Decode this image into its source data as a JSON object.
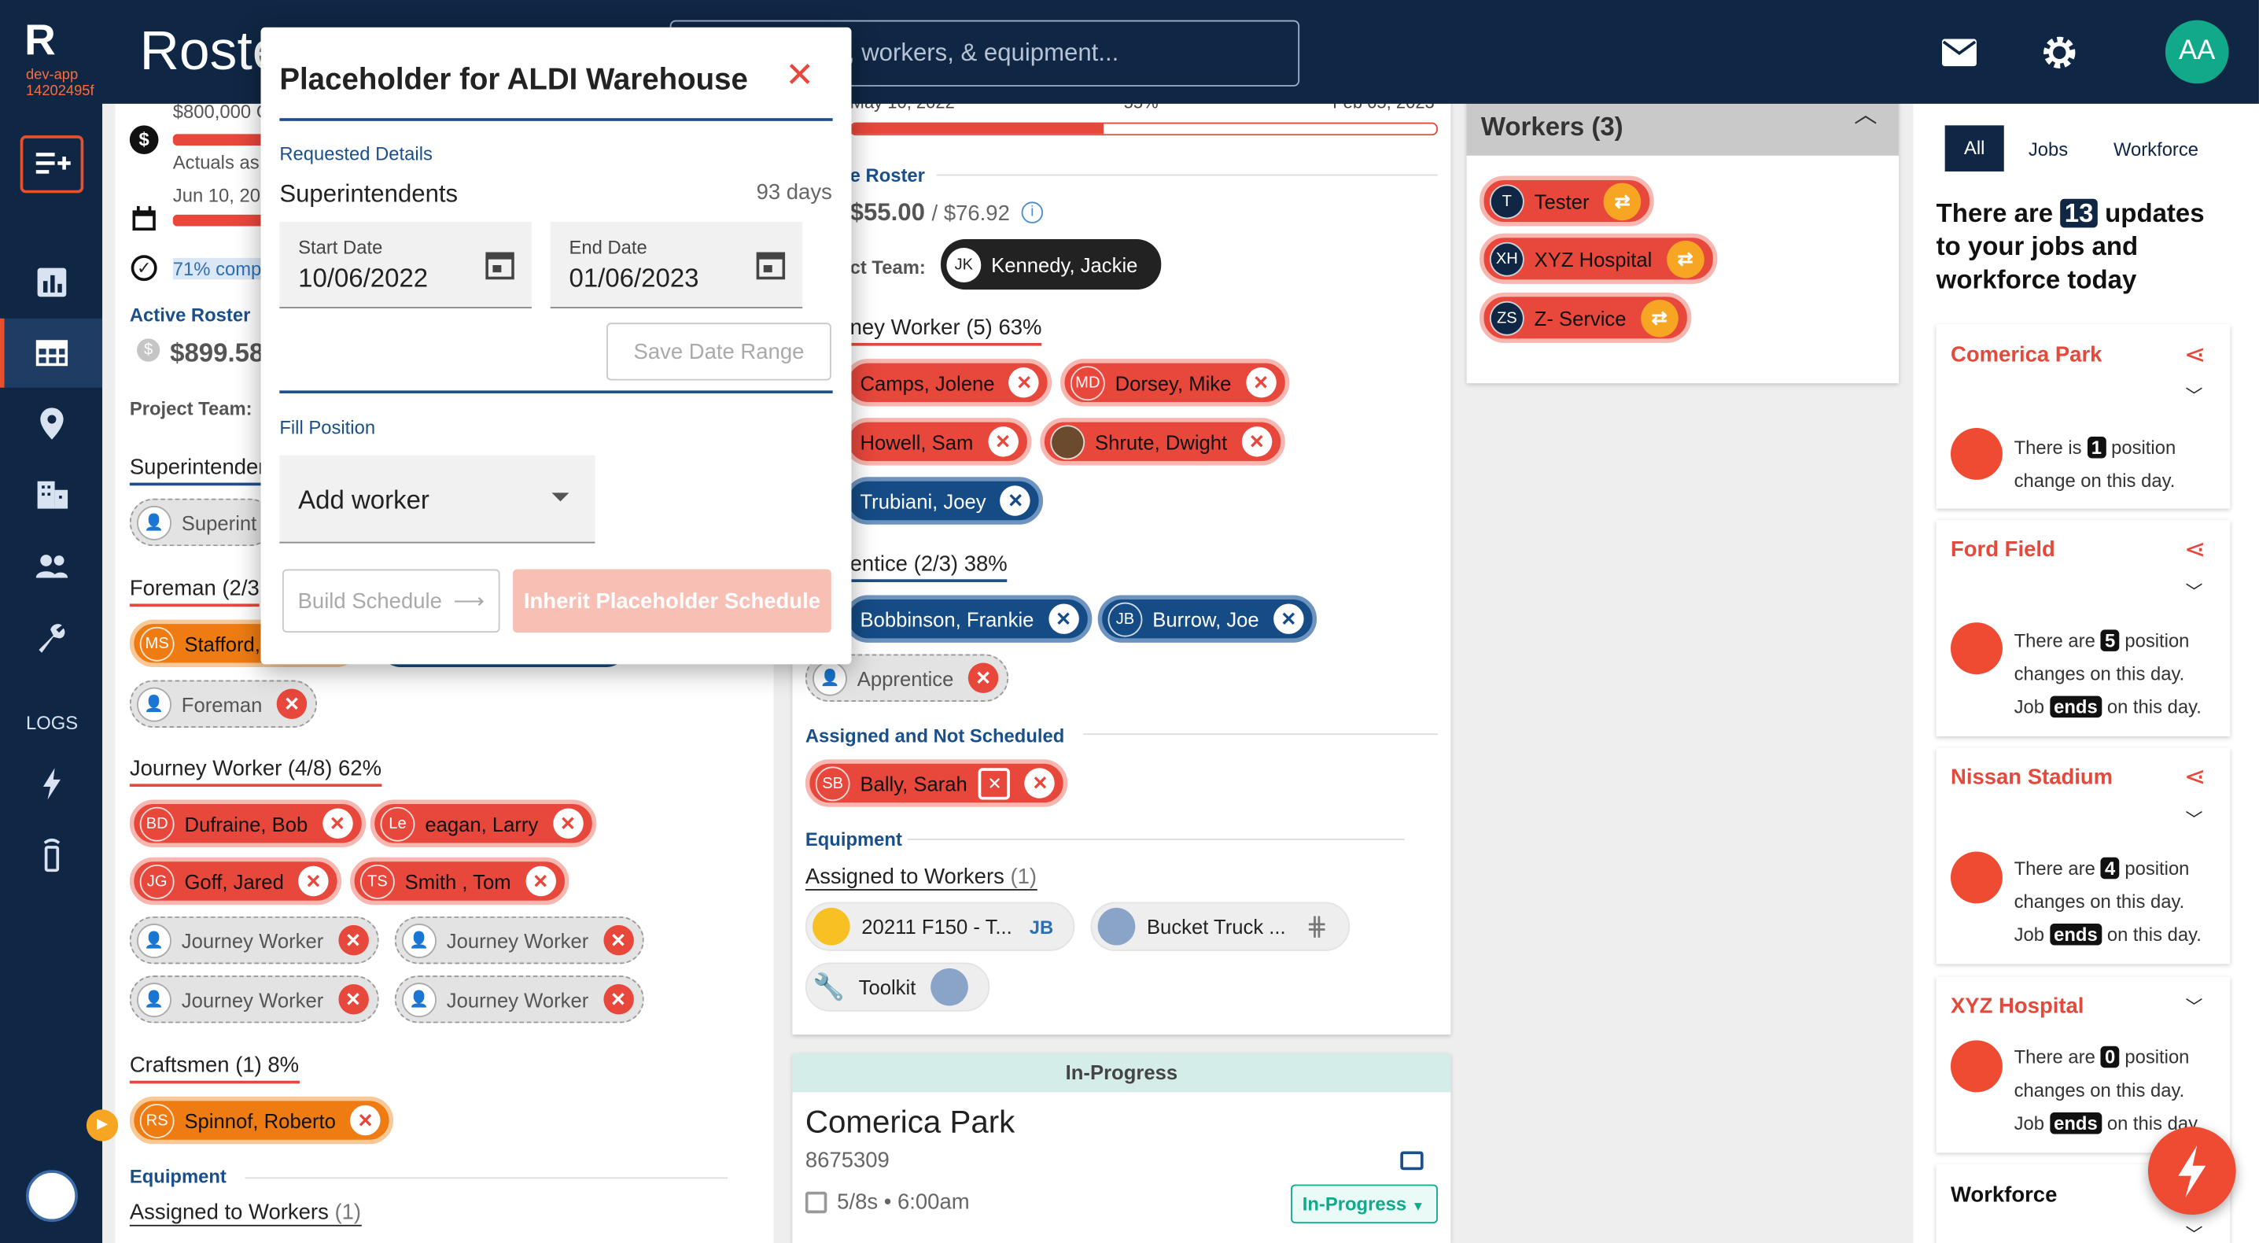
{
  "app": {
    "title": "Roste",
    "logo": "R",
    "env": "dev-app",
    "build": "14202495f",
    "user_initials": "AA",
    "logs_label": "LOGS"
  },
  "search": {
    "placeholder": "s, workers, & equipment..."
  },
  "modal": {
    "title": "Placeholder for ALDI Warehouse",
    "requested_label": "Requested Details",
    "role": "Superintendents",
    "duration": "93 days",
    "start_label": "Start Date",
    "start_value": "10/06/2022",
    "end_label": "End Date",
    "end_value": "01/06/2023",
    "save_range": "Save Date Range",
    "fill_label": "Fill Position",
    "add_worker": "Add worker",
    "build_schedule": "Build Schedule",
    "inherit_schedule": "Inherit Placeholder Schedule"
  },
  "left_panel": {
    "budget": "$800,000 C",
    "actuals": "Actuals as",
    "date": "Jun 10, 20",
    "completion": "71% comp",
    "active_roster_label": "Active Roster",
    "active_roster_value": "$899.58",
    "project_team_label": "Project Team:",
    "superintendent_section": "Superintenden",
    "superintendent_placeholder": "Superint",
    "foreman_section": "Foreman (2/3",
    "foreman_workers": [
      {
        "initials": "MS",
        "name": "Stafford,"
      }
    ],
    "foreman_placeholder": "Foreman",
    "journey_section": "Journey Worker (4/8) 62%",
    "journey_workers": [
      {
        "initials": "BD",
        "name": "Dufraine, Bob"
      },
      {
        "initials": "Le",
        "name": "eagan, Larry"
      },
      {
        "initials": "JG",
        "name": "Goff, Jared"
      },
      {
        "initials": "TS",
        "name": "Smith , Tom"
      }
    ],
    "journey_placeholders": [
      "Journey Worker",
      "Journey Worker",
      "Journey Worker",
      "Journey Worker"
    ],
    "craftsmen_section": "Craftsmen (1) 8%",
    "craftsmen_workers": [
      {
        "initials": "RS",
        "name": "Spinnof, Roberto"
      }
    ],
    "equipment_label": "Equipment",
    "assigned_label": "Assigned to Workers",
    "assigned_count": "(1)"
  },
  "middle_panel": {
    "date_start": "May 10, 2022",
    "progress_pct": "55%",
    "date_end": "Feb 05, 2023",
    "progress_fraction": 0.43,
    "roster_label": "e Roster",
    "roster_value": "$55.00",
    "roster_total": "/ $76.92",
    "team_label": "ct Team:",
    "team_lead": {
      "initials": "JK",
      "name": "Kennedy, Jackie"
    },
    "journey_section": "ney Worker (5) 63%",
    "journey_workers": [
      {
        "initials": "",
        "name": "Camps, Jolene",
        "style": "red"
      },
      {
        "initials": "MD",
        "name": "Dorsey, Mike",
        "style": "red"
      },
      {
        "initials": "",
        "name": "Howell, Sam",
        "style": "red"
      },
      {
        "initials": "",
        "name": "Shrute, Dwight",
        "style": "red"
      },
      {
        "initials": "",
        "name": "Trubiani, Joey",
        "style": "blue"
      }
    ],
    "apprentice_section": "entice (2/3) 38%",
    "apprentice_workers": [
      {
        "initials": "",
        "name": "Bobbinson, Frankie"
      },
      {
        "initials": "JB",
        "name": "Burrow, Joe"
      }
    ],
    "apprentice_placeholder": "Apprentice",
    "not_scheduled_label": "Assigned and Not Scheduled",
    "not_scheduled_workers": [
      {
        "initials": "SB",
        "name": "Bally, Sarah"
      }
    ],
    "equipment_label": "Equipment",
    "assigned_label": "Assigned to Workers",
    "assigned_count": "(1)",
    "equipment": [
      {
        "name": "20211 F150 - T...",
        "tag": "JB"
      },
      {
        "name": "Bucket Truck ..."
      },
      {
        "name": "Toolkit"
      }
    ]
  },
  "job_card": {
    "status_header": "In-Progress",
    "name": "Comerica Park",
    "number": "8675309",
    "schedule": "5/8s • 6:00am",
    "status": "In-Progress"
  },
  "workers_panel": {
    "title": "Workers (3)",
    "workers": [
      {
        "initials": "T",
        "name": "Tester"
      },
      {
        "initials": "XH",
        "name": "XYZ Hospital"
      },
      {
        "initials": "ZS",
        "name": "Z- Service"
      }
    ]
  },
  "updates": {
    "tabs": [
      "All",
      "Jobs",
      "Workforce"
    ],
    "headline_pre": "There are",
    "count": "13",
    "headline_post": "updates to your jobs and workforce today",
    "cards": [
      {
        "title": "Comerica Park",
        "pre": "There is",
        "count": "1",
        "post": "position change on this day.",
        "job_pre": "",
        "job_badge": "",
        "job_post": ""
      },
      {
        "title": "Ford Field",
        "pre": "There are",
        "count": "5",
        "post": "position changes on this day.",
        "job_pre": "Job",
        "job_badge": "ends",
        "job_post": "on this day."
      },
      {
        "title": "Nissan Stadium",
        "pre": "There are",
        "count": "4",
        "post": "position changes on this day.",
        "job_pre": "Job",
        "job_badge": "ends",
        "job_post": "on this day."
      },
      {
        "title": "XYZ Hospital",
        "pre": "There are",
        "count": "0",
        "post": "position changes on this day.",
        "job_pre": "Job",
        "job_badge": "ends",
        "job_post": "on this day."
      }
    ],
    "workforce_label": "Workforce"
  },
  "colors": {
    "navy": "#0f2744",
    "accent": "#e8502d",
    "red_chip": "#e8473c",
    "blue_chip": "#154c86",
    "orange_chip": "#ef7c12",
    "green": "#12a88a"
  }
}
